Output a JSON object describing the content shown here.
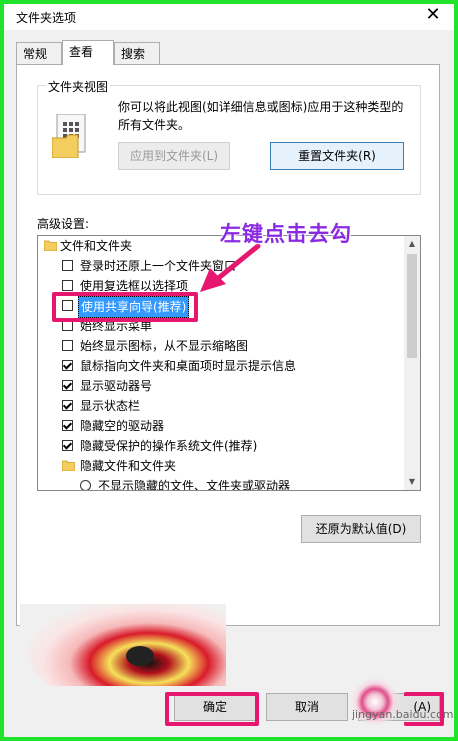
{
  "window": {
    "title": "文件夹选项",
    "close_glyph": "✕"
  },
  "tabs": [
    {
      "label": "常规"
    },
    {
      "label": "查看"
    },
    {
      "label": "搜索"
    }
  ],
  "folder_views": {
    "group_title": "文件夹视图",
    "description": "你可以将此视图(如详细信息或图标)应用于这种类型的所有文件夹。",
    "apply_button": "应用到文件夹(L)",
    "reset_button": "重置文件夹(R)"
  },
  "advanced": {
    "label": "高级设置:",
    "items": [
      {
        "type": "folder",
        "label": "文件和文件夹"
      },
      {
        "type": "checkbox",
        "checked": false,
        "label": "登录时还原上一个文件夹窗口"
      },
      {
        "type": "checkbox",
        "checked": false,
        "label": "使用复选框以选择项"
      },
      {
        "type": "checkbox",
        "checked": false,
        "label": "使用共享向导(推荐)",
        "selected": true
      },
      {
        "type": "checkbox",
        "checked": false,
        "label": "始终显示菜单"
      },
      {
        "type": "checkbox",
        "checked": false,
        "label": "始终显示图标，从不显示缩略图"
      },
      {
        "type": "checkbox",
        "checked": true,
        "label": "鼠标指向文件夹和桌面项时显示提示信息"
      },
      {
        "type": "checkbox",
        "checked": true,
        "label": "显示驱动器号"
      },
      {
        "type": "checkbox",
        "checked": true,
        "label": "显示状态栏"
      },
      {
        "type": "checkbox",
        "checked": true,
        "label": "隐藏空的驱动器"
      },
      {
        "type": "checkbox",
        "checked": true,
        "label": "隐藏受保护的操作系统文件(推荐)"
      },
      {
        "type": "folder",
        "label": "隐藏文件和文件夹"
      },
      {
        "type": "radio",
        "checked": false,
        "label": "不显示隐藏的文件、文件夹或驱动器"
      }
    ],
    "restore_button": "还原为默认值(D)"
  },
  "footer": {
    "ok_button": "确定",
    "cancel_button": "取消",
    "apply_button": "(A)"
  },
  "annotation": {
    "text": "左键点击去勾"
  },
  "watermark": "jingyan.baidu.com",
  "colors": {
    "frame_green": "#22e32b",
    "highlight_pink": "#e6176f",
    "annotation_purple": "#8a2be2",
    "selection_blue": "#3399ff"
  }
}
